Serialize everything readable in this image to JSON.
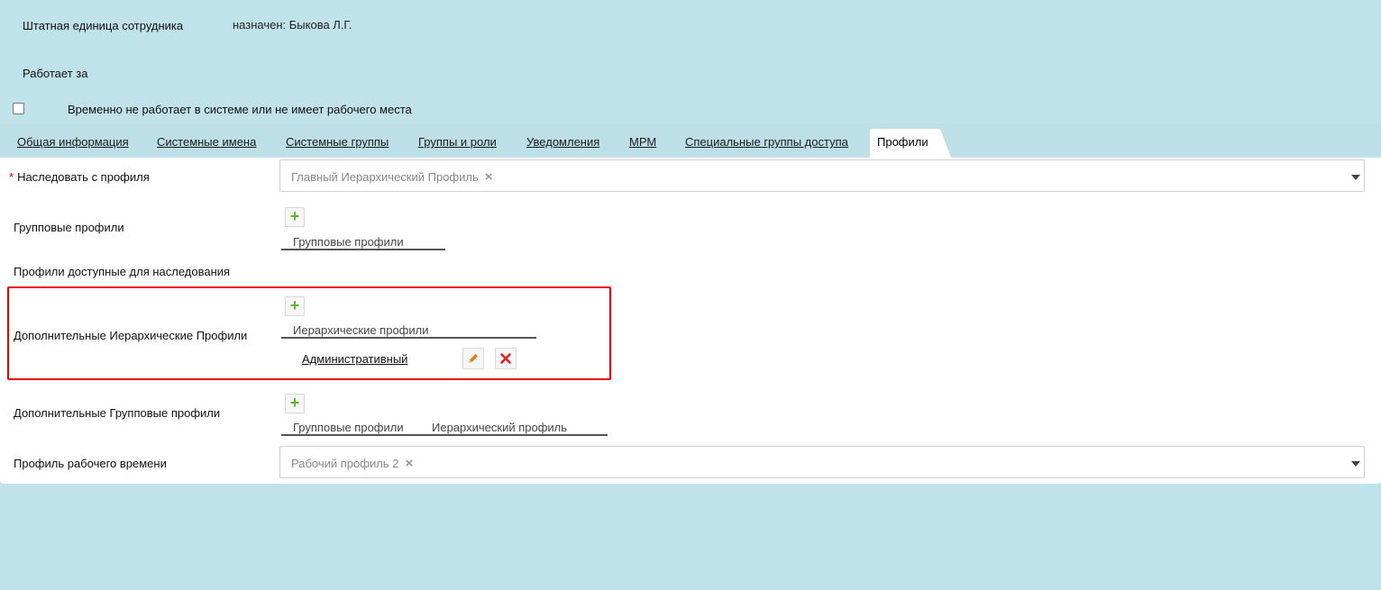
{
  "header": {
    "staff_unit_label": "Штатная единица сотрудника",
    "staff_unit_value": "назначен: Быкова Л.Г.",
    "works_for_label": "Работает за",
    "temp_absent_label": "Временно не работает в системе или не имеет рабочего места",
    "temp_absent_checked": false
  },
  "tabs": [
    {
      "label": "Общая информация"
    },
    {
      "label": "Системные имена"
    },
    {
      "label": "Системные группы"
    },
    {
      "label": "Группы и роли"
    },
    {
      "label": "Уведомления"
    },
    {
      "label": "МРМ"
    },
    {
      "label": "Специальные группы доступа"
    },
    {
      "label": "Профили",
      "active": true
    }
  ],
  "form": {
    "inherit": {
      "required_mark": "*",
      "label": "Наследовать с профиля",
      "value": "Главный Иерархический Профиль",
      "clear_icon": "close-icon"
    },
    "group_profiles": {
      "label": "Групповые профили",
      "column": "Групповые профили"
    },
    "available_for_inherit": {
      "label": "Профили доступные для наследования"
    },
    "extra_hier": {
      "label": "Дополнительные Иерархические Профили",
      "column": "Иерархические профили",
      "items": [
        {
          "name": "Административный",
          "edit_icon": "pencil-icon",
          "delete_icon": "delete-icon"
        }
      ]
    },
    "extra_group": {
      "label": "Дополнительные Групповые профили",
      "columns": [
        "Групповые профили",
        "Иерархический профиль"
      ]
    },
    "work_time": {
      "label": "Профиль рабочего времени",
      "value": "Рабочий профиль 2",
      "clear_icon": "close-icon"
    }
  },
  "colors": {
    "background": "#c0e2ea",
    "highlight_border": "#e00000",
    "add_icon": "#5cb82e",
    "edit_icon": "#e07b1c",
    "delete_icon": "#d9252a",
    "required": "#dd0000"
  }
}
